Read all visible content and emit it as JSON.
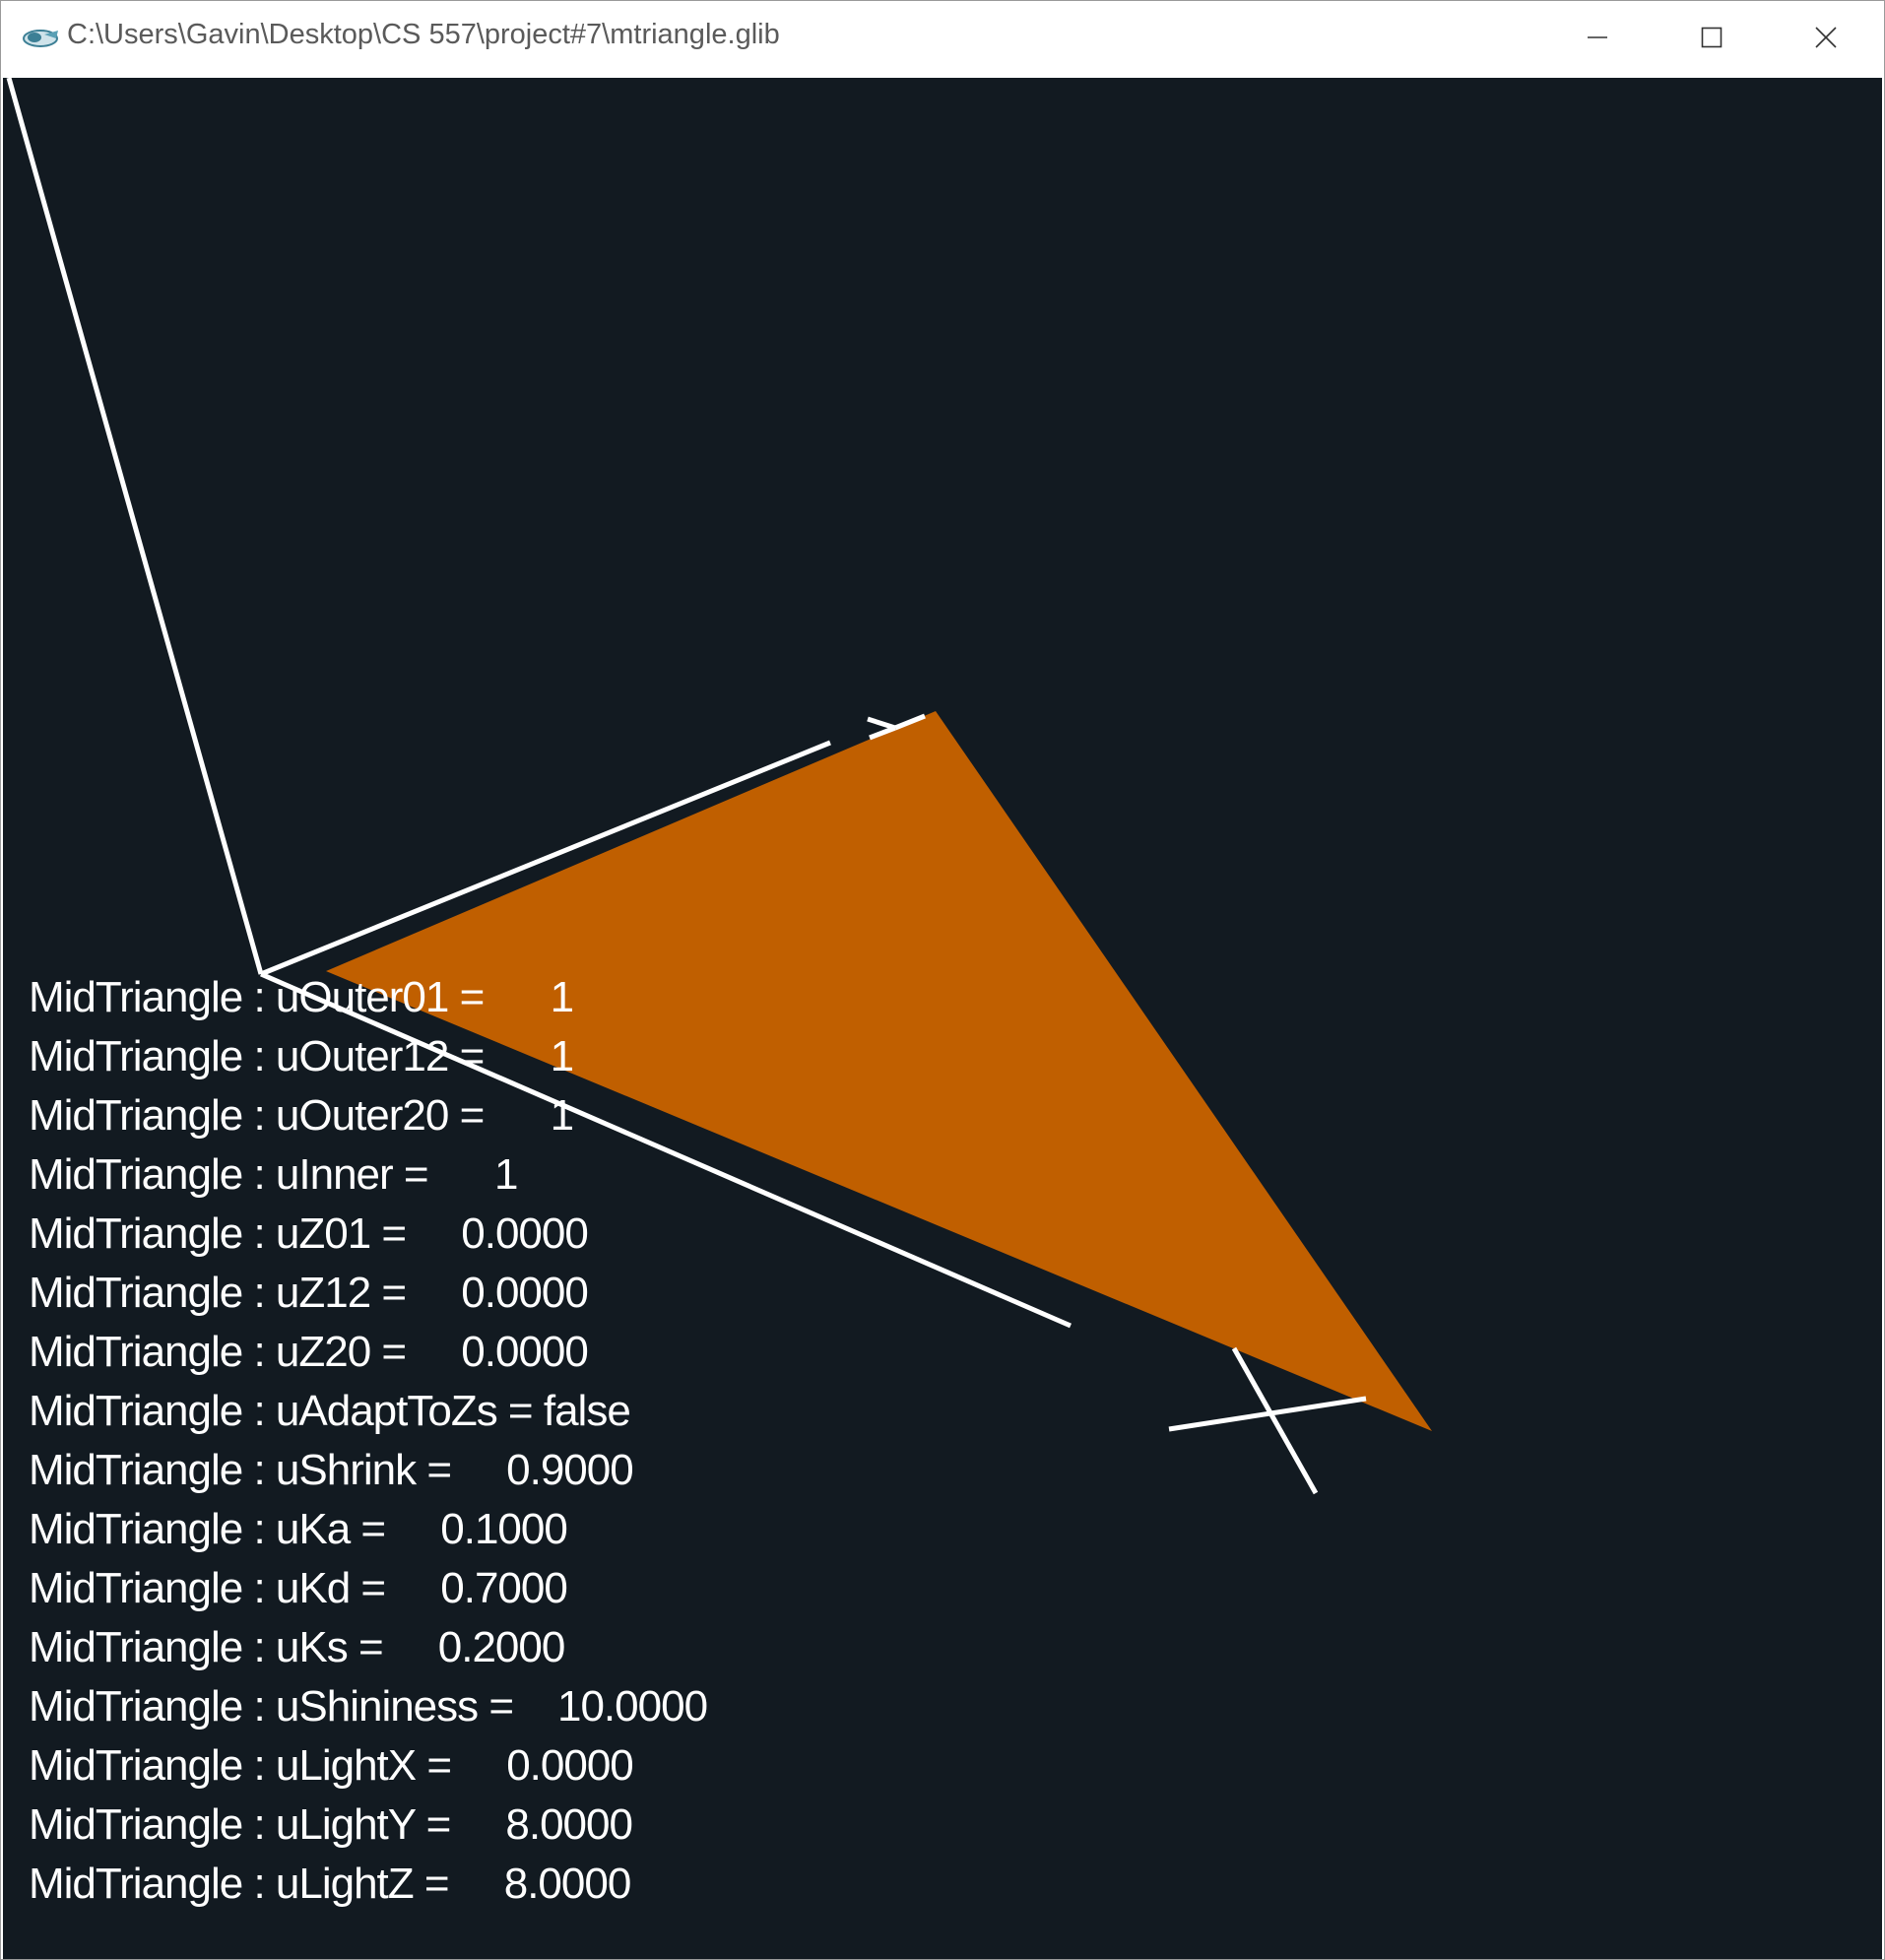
{
  "window": {
    "title": "C:\\Users\\Gavin\\Desktop\\CS 557\\project#7\\mtriangle.glib",
    "minimize_icon": "minimize-icon",
    "maximize_icon": "maximize-icon",
    "close_icon": "close-icon"
  },
  "scene": {
    "background_color": "#121a21",
    "triangle_color": "#c05f00",
    "axis_color": "#ffffff"
  },
  "uniforms": [
    {
      "label": "MidTriangle : uOuter01 =",
      "value": "1"
    },
    {
      "label": "MidTriangle : uOuter12 =",
      "value": "1"
    },
    {
      "label": "MidTriangle : uOuter20 =",
      "value": "1"
    },
    {
      "label": "MidTriangle : uInner =",
      "value": "1"
    },
    {
      "label": "MidTriangle : uZ01 =",
      "value": "0.0000"
    },
    {
      "label": "MidTriangle : uZ12 =",
      "value": "0.0000"
    },
    {
      "label": "MidTriangle : uZ20 =",
      "value": "0.0000"
    },
    {
      "label": "MidTriangle : uAdaptToZs =",
      "value": "false"
    },
    {
      "label": "MidTriangle : uShrink =",
      "value": "0.9000"
    },
    {
      "label": "MidTriangle : uKa =",
      "value": "0.1000"
    },
    {
      "label": "MidTriangle : uKd =",
      "value": "0.7000"
    },
    {
      "label": "MidTriangle : uKs =",
      "value": "0.2000"
    },
    {
      "label": "MidTriangle : uShininess =",
      "value": "10.0000"
    },
    {
      "label": "MidTriangle : uLightX =",
      "value": "0.0000"
    },
    {
      "label": "MidTriangle : uLightY =",
      "value": "8.0000"
    },
    {
      "label": "MidTriangle : uLightZ =",
      "value": "8.0000"
    }
  ]
}
